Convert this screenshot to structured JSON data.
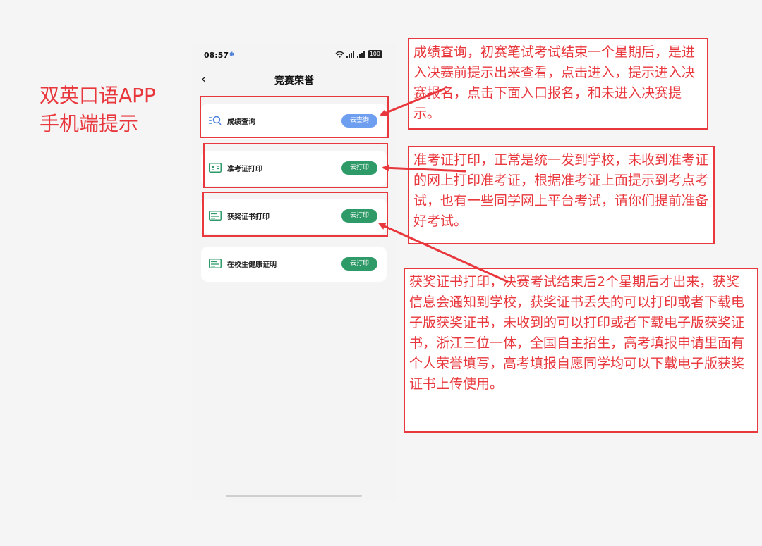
{
  "side_title": [
    "双英口语APP",
    "手机端提示"
  ],
  "phone": {
    "status": {
      "time": "08:57",
      "bt_icon": "bluetooth-icon",
      "wifi_icon": "wifi-icon",
      "signal_icon": "signal-icon",
      "battery": "100"
    },
    "nav": {
      "back_icon": "chevron-left-icon",
      "title": "竞赛荣誉"
    },
    "items": [
      {
        "icon": "search-list-icon",
        "label": "成绩查询",
        "button": "去查询",
        "button_color": "#6e9ef0"
      },
      {
        "icon": "id-card-icon",
        "label": "准考证打印",
        "button": "去打印",
        "button_color": "#2e9a67"
      },
      {
        "icon": "certificate-icon",
        "label": "获奖证书打印",
        "button": "去打印",
        "button_color": "#2e9a67"
      },
      {
        "icon": "certificate-icon",
        "label": "在校生健康证明",
        "button": "去打印",
        "button_color": "#2e9a67"
      }
    ]
  },
  "annotations": [
    {
      "text": "成绩查询，初赛笔试考试结束一个星期后，是进入决赛前提示出来查看，点击进入，提示进入决赛报名，点击下面入口报名，和未进入决赛提示。"
    },
    {
      "text": "准考证打印，正常是统一发到学校，未收到准考证的网上打印准考证，根据准考证上面提示到考点考试，也有一些同学网上平台考试，请你们提前准备好考试。"
    },
    {
      "text": "获奖证书打印，决赛考试结束后2个星期后才出来，获奖信息会通知到学校，获奖证书丢失的可以打印或者下载电子版获奖证书，未收到的可以打印或者下载电子版获奖证书，浙江三位一体，全国自主招生，高考填报申请里面有个人荣誉填写，高考填报自愿同学均可以下载电子版获奖证书上传使用。"
    }
  ],
  "colors": {
    "annotation_red": "#e8383d",
    "primary_green": "#2e9a67",
    "query_blue": "#6e9ef0"
  }
}
